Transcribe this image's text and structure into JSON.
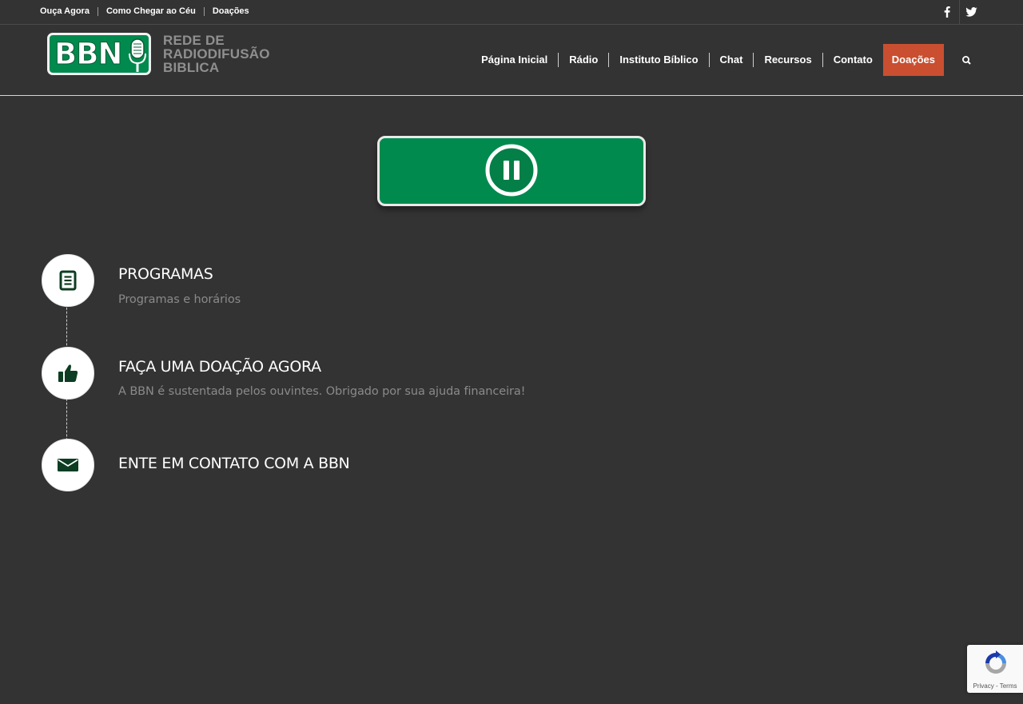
{
  "topbar": {
    "links": [
      "Ouça Agora",
      "Como Chegar ao Céu",
      "Doações"
    ],
    "social": [
      {
        "icon": "facebook-icon"
      },
      {
        "icon": "twitter-icon"
      }
    ]
  },
  "logo": {
    "badge_text": "BBN",
    "line1": "REDE DE",
    "line2": "RADIODIFUSÃO",
    "line3": "BIBLICA"
  },
  "nav": {
    "items": [
      "Página Inicial",
      "Rádio",
      "Instituto Bíblico",
      "Chat",
      "Recursos",
      "Contato"
    ],
    "donate": "Doações",
    "search_icon": "search-icon"
  },
  "player": {
    "state_icon": "pause-icon"
  },
  "sections": [
    {
      "title": "PROGRAMAS",
      "desc": "Programas e horários",
      "icon": "document-icon"
    },
    {
      "title": "FAÇA UMA DOAÇÃO AGORA",
      "desc": "A BBN é sustentada pelos ouvintes. Obrigado por sua ajuda financeira!",
      "icon": "thumbs-up-icon"
    },
    {
      "title": "ENTE EM CONTATO COM A BBN",
      "desc": "",
      "icon": "envelope-icon"
    }
  ],
  "recaptcha": {
    "text": "Privacy - Terms"
  },
  "colors": {
    "background": "#333333",
    "brand_green": "#008a4e",
    "donate_accent": "#c94f30",
    "icon_dark_green": "#0d3d22"
  }
}
